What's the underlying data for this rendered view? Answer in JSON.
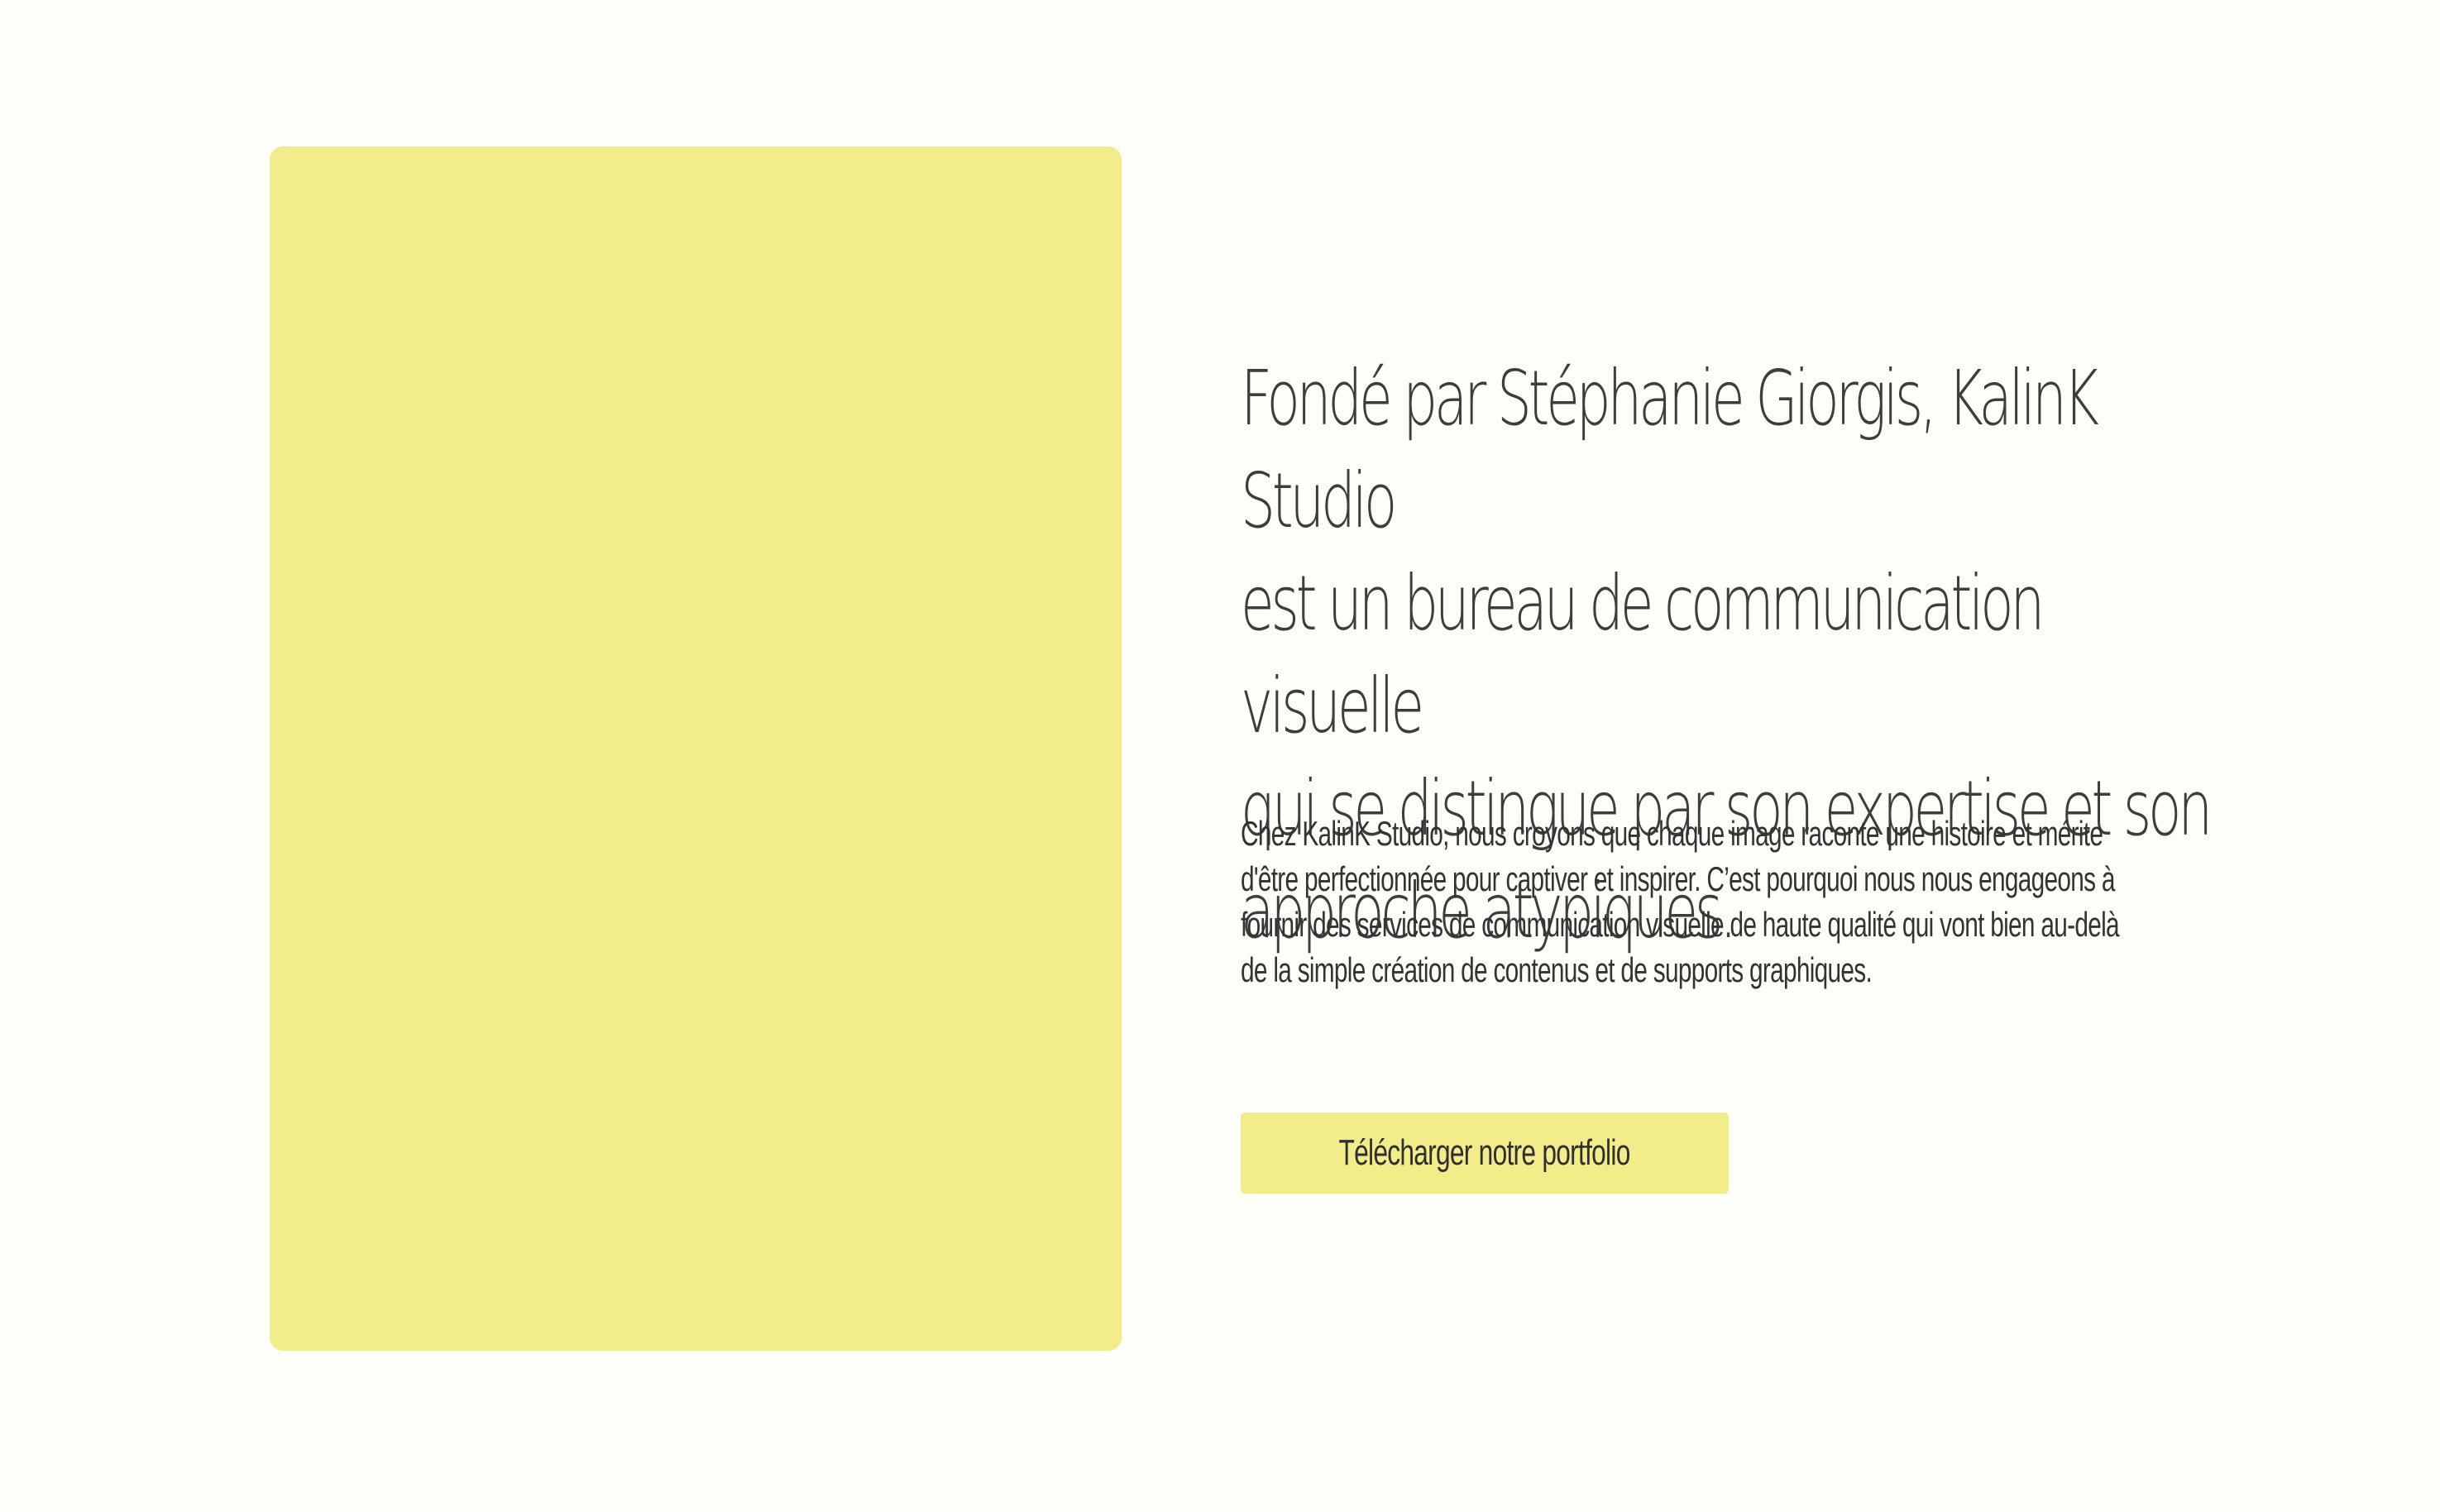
{
  "hero": {
    "headline_lines": [
      "Fondé par Stéphanie Giorgis, KalinK Studio",
      "est un bureau de communication visuelle",
      "qui se distingue par son expertise et son",
      "approche atypiques."
    ],
    "body_lines": [
      "Chez KalinK Studio, nous croyons que chaque image raconte une histoire et mérite",
      "d'être perfectionnée pour captiver et inspirer. C’est pourquoi nous nous engageons à",
      "fournir des services de communication visuelle de haute qualité qui vont bien au-delà",
      "de la simple création de contenus et de supports graphiques."
    ],
    "cta_label": "Télécharger notre portfolio"
  },
  "colors": {
    "background": "#fefef9",
    "accent_yellow": "#f3ec8b",
    "text": "#3a3a3a"
  }
}
